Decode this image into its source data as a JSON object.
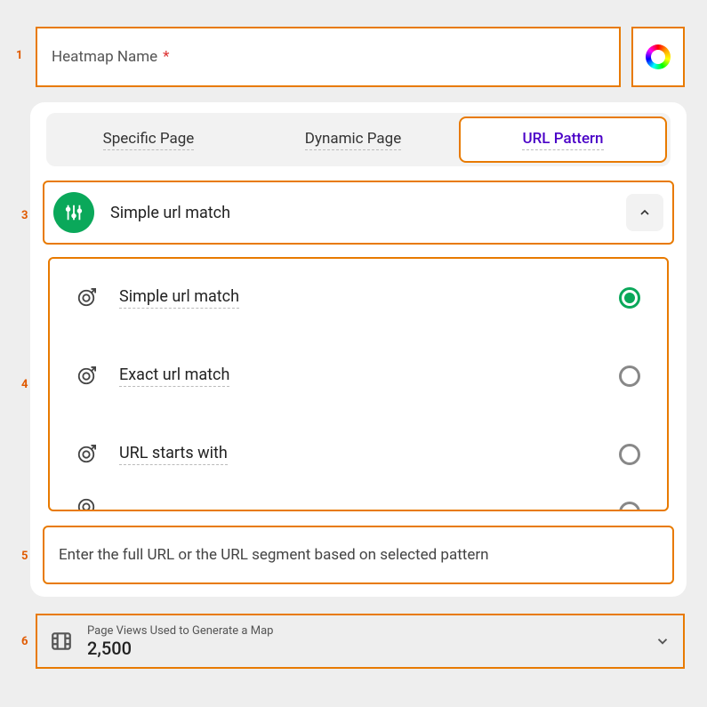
{
  "name_field": {
    "label": "Heatmap Name",
    "required_mark": "*"
  },
  "tabs": {
    "t0": "Specific Page",
    "t1": "Dynamic Page",
    "t2": "URL Pattern"
  },
  "dropdown": {
    "selected_label": "Simple url match",
    "options": {
      "o0": "Simple url match",
      "o1": "Exact url match",
      "o2": "URL starts with"
    }
  },
  "url_input": {
    "placeholder": "Enter the full URL or the URL segment based on selected pattern"
  },
  "pageviews": {
    "label": "Page Views Used to Generate a Map",
    "value": "2,500"
  },
  "markers": {
    "m1": "1",
    "m2": "2",
    "m3": "3",
    "m4": "4",
    "m5": "5",
    "m6": "6"
  }
}
